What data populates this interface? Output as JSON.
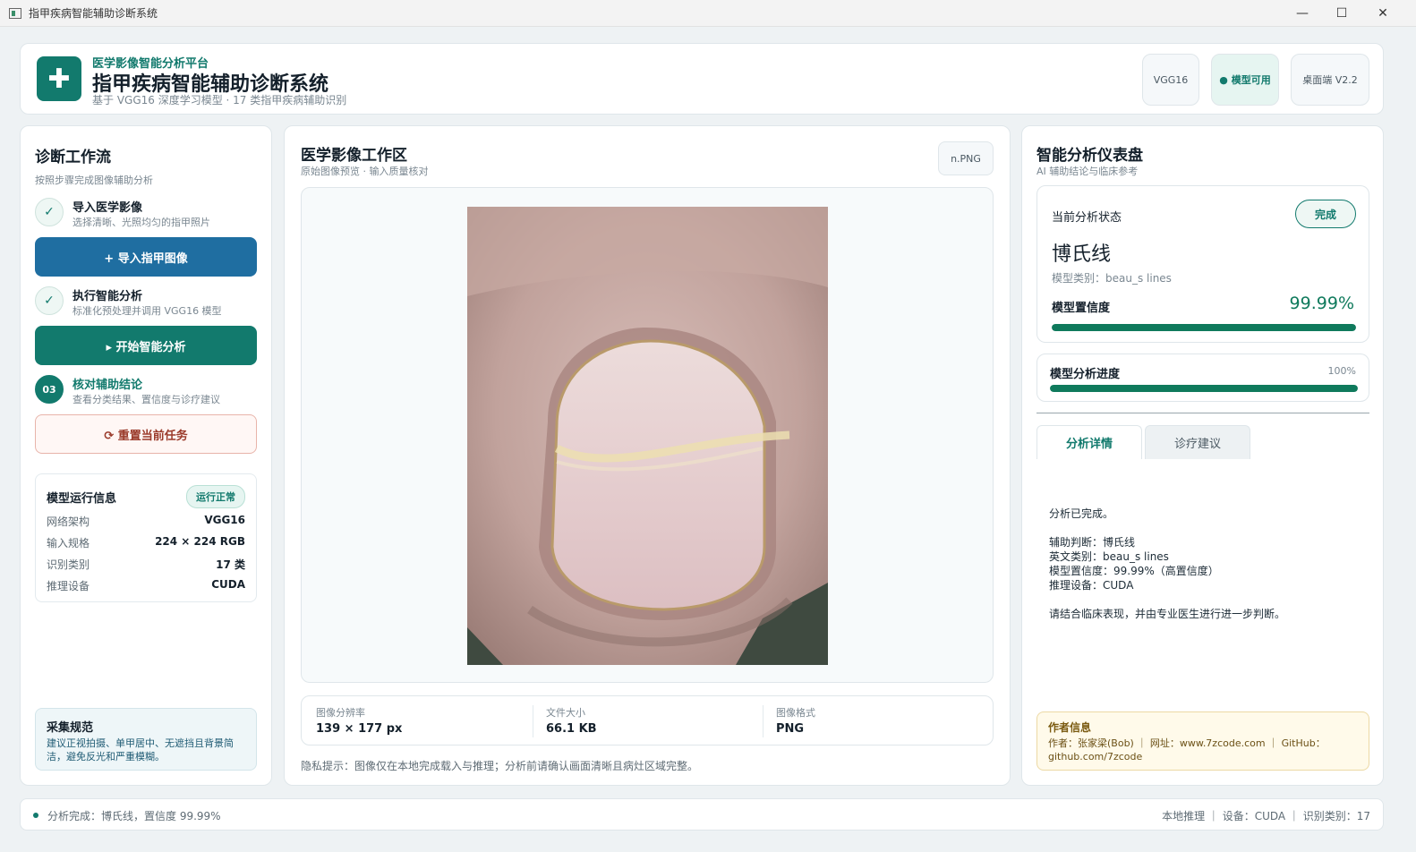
{
  "window": {
    "title": "指甲疾病智能辅助诊断系统",
    "minimize": "—",
    "maximize": "☐",
    "close": "✕"
  },
  "header": {
    "logo_glyph": "✚",
    "subtitle": "医学影像智能分析平台",
    "title": "指甲疾病智能辅助诊断系统",
    "description": "基于 VGG16 深度学习模型 · 17 类指甲疾病辅助识别",
    "pills": {
      "model": "VGG16",
      "status": "● 模型可用",
      "version": "桌面端 V2.2"
    }
  },
  "workflow": {
    "title": "诊断工作流",
    "subtitle": "按照步骤完成图像辅助分析",
    "steps": [
      {
        "badge": "✓",
        "title": "导入医学影像",
        "desc": "选择清晰、光照均匀的指甲照片"
      },
      {
        "badge": "✓",
        "title": "执行智能分析",
        "desc": "标准化预处理并调用 VGG16 模型"
      },
      {
        "badge": "03",
        "title": "核对辅助结论",
        "desc": "查看分类结果、置信度与诊疗建议"
      }
    ],
    "import_button": "+ 导入指甲图像",
    "analyze_button": "▸ 开始智能分析",
    "reset_button": "⟳ 重置当前任务",
    "model_info": {
      "title": "模型运行信息",
      "badge": "运行正常",
      "rows": [
        {
          "k": "网络架构",
          "v": "VGG16"
        },
        {
          "k": "输入规格",
          "v": "224 × 224 RGB"
        },
        {
          "k": "识别类别",
          "v": "17 类"
        },
        {
          "k": "推理设备",
          "v": "CUDA"
        }
      ]
    },
    "spec": {
      "title": "采集规范",
      "text": "建议正视拍摄、单甲居中、无遮挡且背景简洁，避免反光和严重模糊。"
    }
  },
  "workspace": {
    "title": "医学影像工作区",
    "subtitle": "原始图像预览 · 输入质量核对",
    "format_badge": "n.PNG",
    "meta": [
      {
        "k": "图像分辨率",
        "v": "139 × 177 px"
      },
      {
        "k": "文件大小",
        "v": "66.1 KB"
      },
      {
        "k": "图像格式",
        "v": "PNG"
      }
    ],
    "privacy": "隐私提示：图像仅在本地完成载入与推理；分析前请确认画面清晰且病灶区域完整。"
  },
  "dashboard": {
    "title": "智能分析仪表盘",
    "subtitle": "AI 辅助结论与临床参考",
    "status_label": "当前分析状态",
    "status_badge": "完成",
    "diagnosis": "博氏线",
    "category": "模型类别：beau_s lines",
    "confidence_label": "模型置信度",
    "confidence_value": "99.99%",
    "confidence_fraction": 0.9999,
    "progress_label": "模型分析进度",
    "progress_value": "100%",
    "progress_fraction": 1.0,
    "tabs": [
      "分析详情",
      "诊疗建议"
    ],
    "details": [
      "分析已完成。",
      "辅助判断：博氏线",
      "英文类别：beau_s lines",
      "模型置信度：99.99%（高置信度）",
      "推理设备：CUDA",
      "请结合临床表现，并由专业医生进行进一步判断。"
    ],
    "author": {
      "title": "作者信息",
      "text": "作者：张家梁(Bob) ｜ 网址：www.7zcode.com ｜ GitHub：github.com/7zcode"
    }
  },
  "statusbar": {
    "left": "分析完成：博氏线，置信度 99.99%",
    "right": "本地推理 ｜ 设备：CUDA ｜ 识别类别：17"
  },
  "colors": {
    "accent": "#127a6d",
    "blue": "#1f6ea1",
    "progress": "#0f7a5c"
  }
}
